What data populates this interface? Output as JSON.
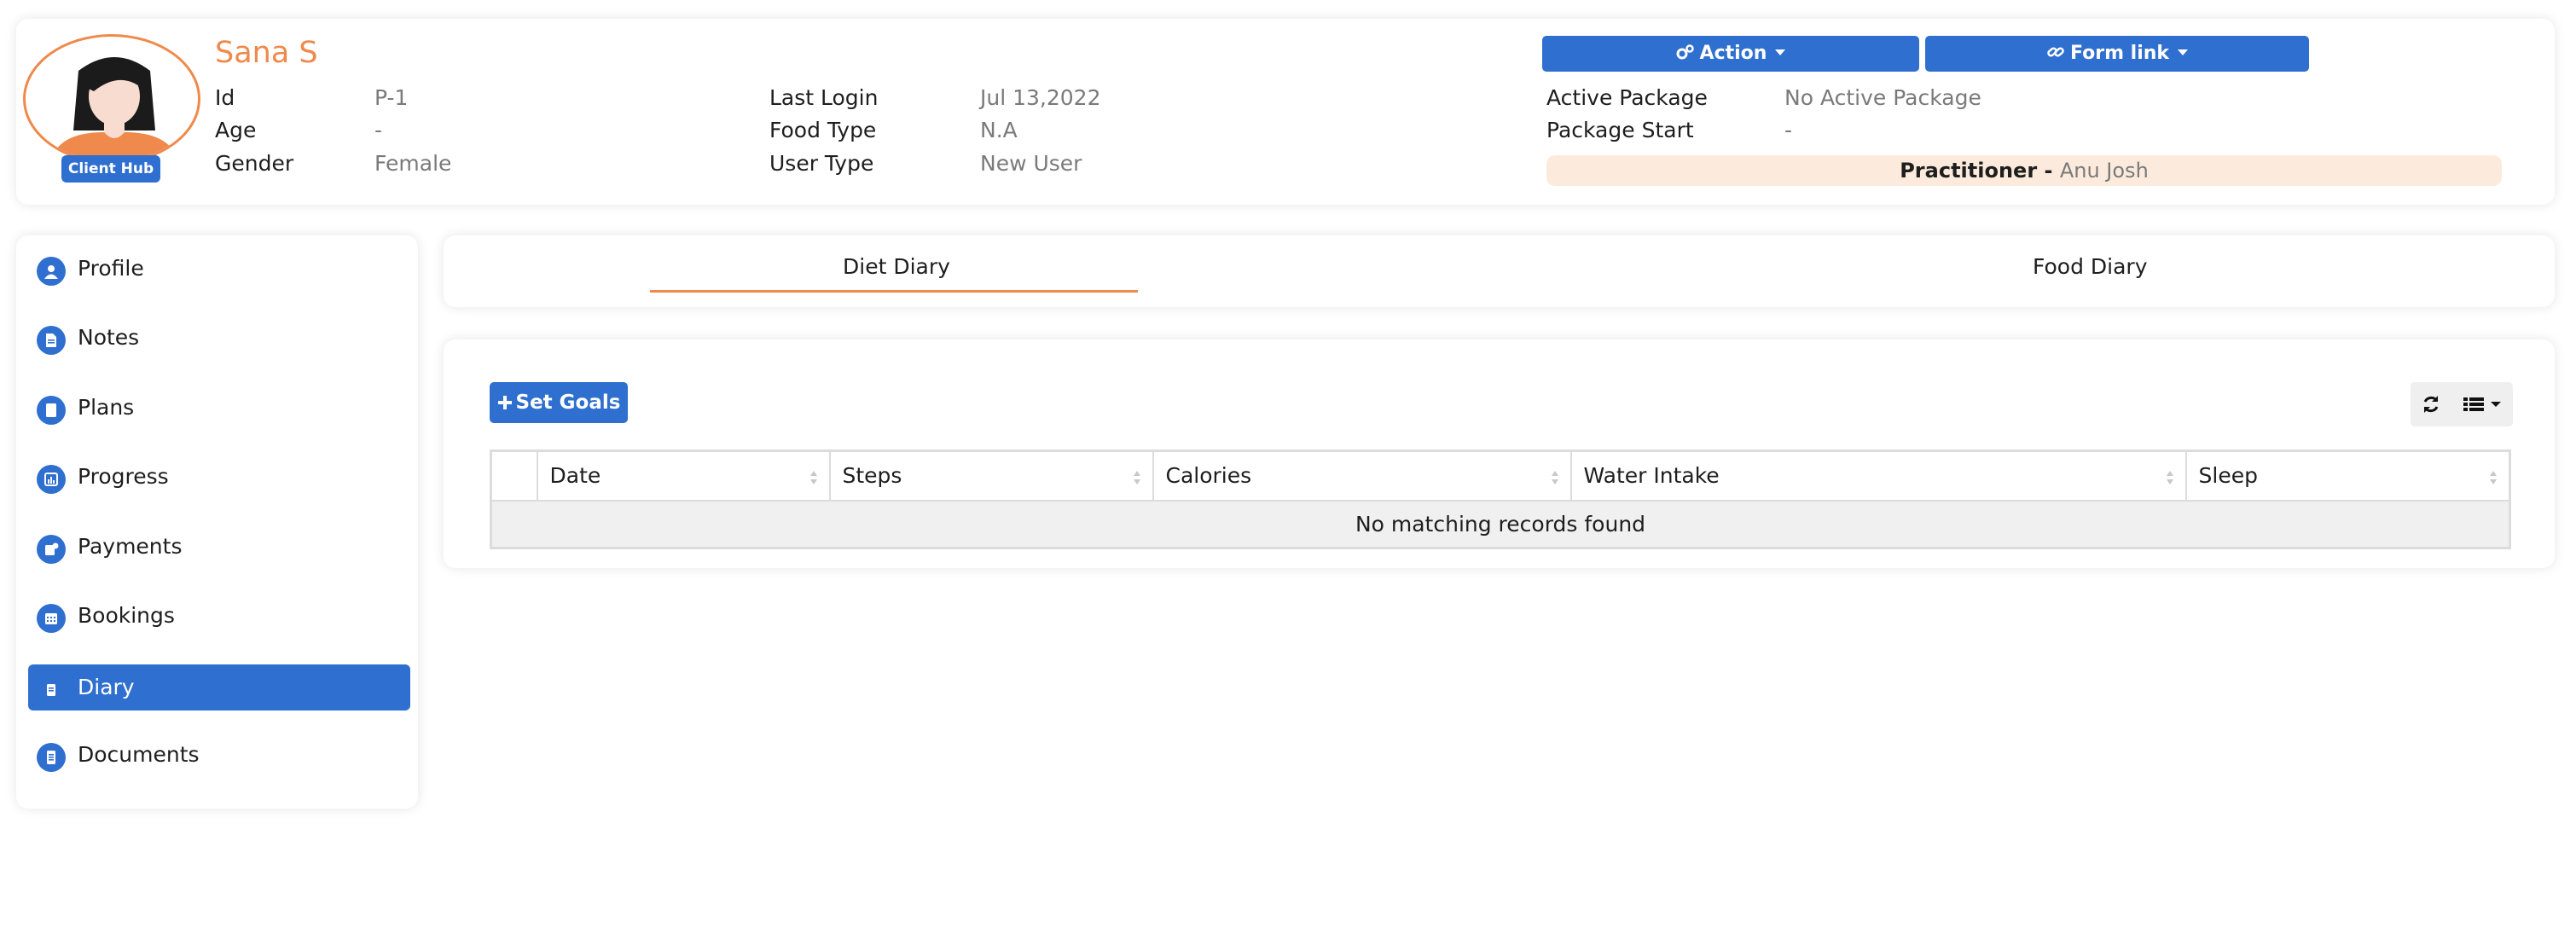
{
  "client": {
    "name": "Sana S",
    "badge": "Client Hub"
  },
  "info": {
    "id_label": "Id",
    "id_value": "P-1",
    "age_label": "Age",
    "age_value": "-",
    "gender_label": "Gender",
    "gender_value": "Female",
    "last_login_label": "Last Login",
    "last_login_value": "Jul 13,2022",
    "food_type_label": "Food Type",
    "food_type_value": "N.A",
    "user_type_label": "User Type",
    "user_type_value": "New User",
    "active_package_label": "Active Package",
    "active_package_value": "No Active Package",
    "package_start_label": "Package Start",
    "package_start_value": "-"
  },
  "header_buttons": {
    "action": "Action",
    "form_link": "Form link"
  },
  "practitioner": {
    "label": "Practitioner - ",
    "name": "Anu Josh"
  },
  "sidebar": {
    "items": [
      {
        "label": "Profile",
        "icon": "user-icon"
      },
      {
        "label": "Notes",
        "icon": "notes-icon"
      },
      {
        "label": "Plans",
        "icon": "plans-icon"
      },
      {
        "label": "Progress",
        "icon": "progress-chart-icon"
      },
      {
        "label": "Payments",
        "icon": "payments-icon"
      },
      {
        "label": "Bookings",
        "icon": "calendar-icon"
      },
      {
        "label": "Diary",
        "icon": "diary-icon",
        "active": true
      },
      {
        "label": "Documents",
        "icon": "document-icon"
      }
    ]
  },
  "tabs": {
    "diet_diary": "Diet Diary",
    "food_diary": "Food Diary",
    "active": "Diet Diary"
  },
  "panel": {
    "set_goals": "Set Goals",
    "columns": [
      "Date",
      "Steps",
      "Calories",
      "Water Intake",
      "Sleep"
    ],
    "empty_message": "No matching records found"
  },
  "colors": {
    "primary": "#2f6fcf",
    "accent": "#f0894c",
    "practitioner_bg": "#fcebdc"
  }
}
